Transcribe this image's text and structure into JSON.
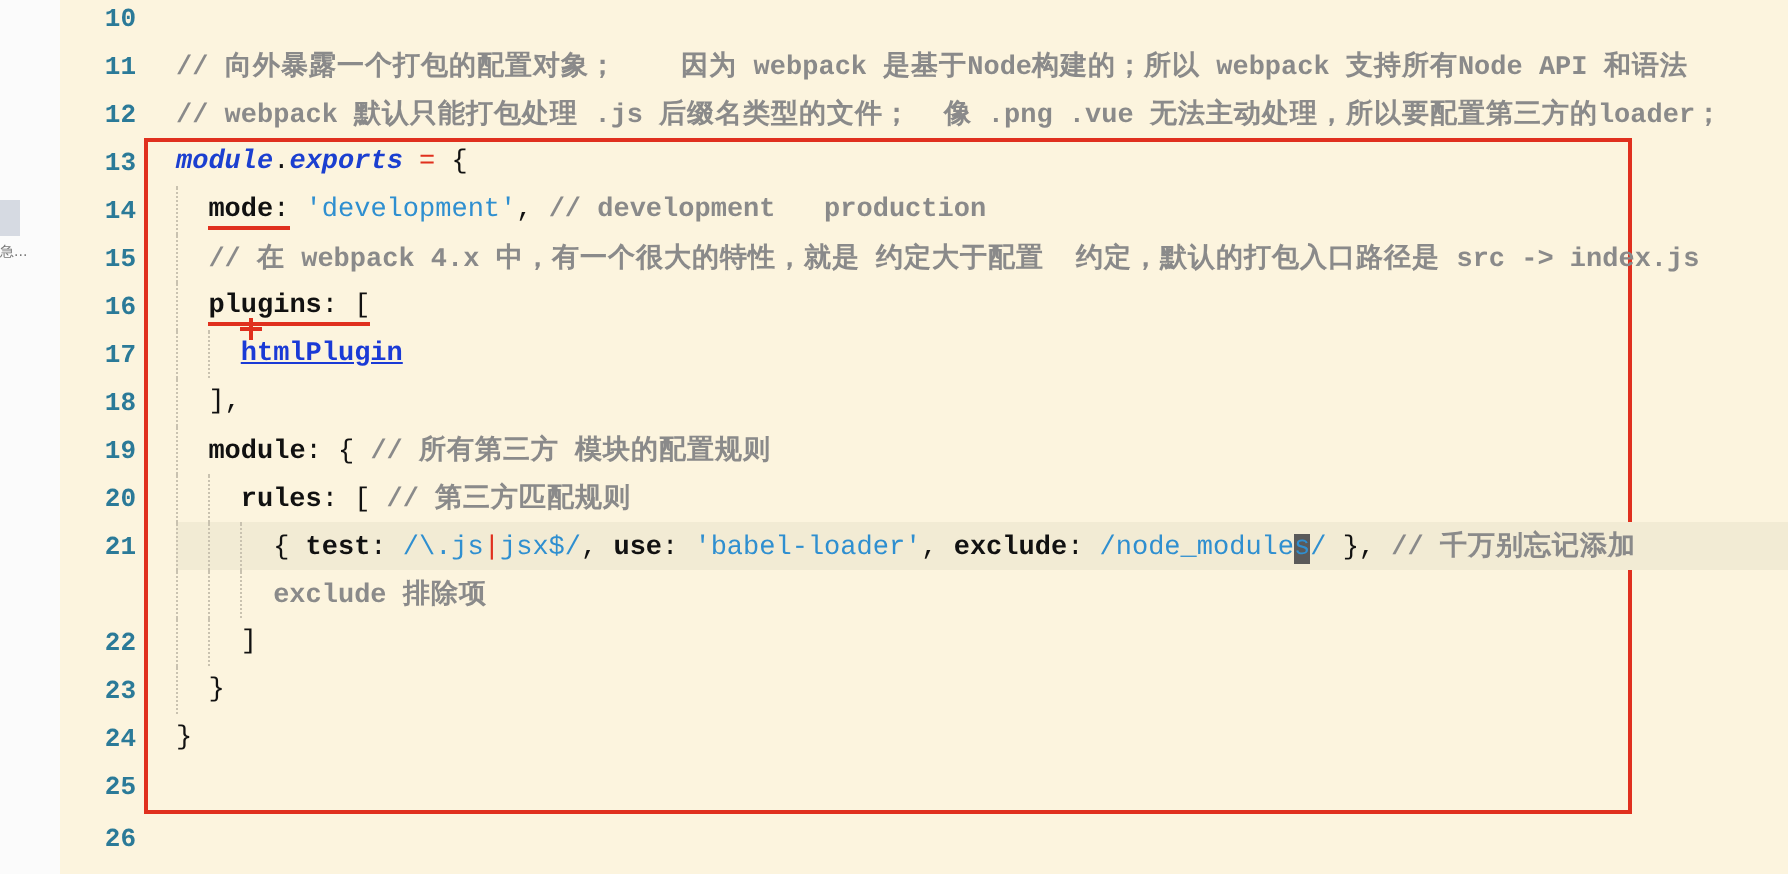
{
  "sidebar": {
    "item_text": "急..."
  },
  "editor": {
    "lines_before": [
      {
        "number": "10"
      },
      {
        "number": "11",
        "tokens": [
          {
            "kind": "comment",
            "text": "// 向外暴露一个打包的配置对象；    因为 webpack 是基于Node构建的；所以 webpack 支持所有Node API 和语法"
          }
        ]
      },
      {
        "number": "12",
        "tokens": [
          {
            "kind": "comment",
            "text": "// webpack 默认只能打包处理 .js 后缀名类型的文件；  像 .png .vue 无法主动处理，所以要配置第三方的loader；"
          }
        ]
      }
    ],
    "boxed_lines": [
      {
        "number": "13",
        "tokens": [
          {
            "kind": "keyword",
            "text": "module"
          },
          {
            "kind": "punct",
            "text": "."
          },
          {
            "kind": "keyword",
            "text": "exports"
          },
          {
            "kind": "operator",
            "text": " = "
          },
          {
            "kind": "punct",
            "text": "{"
          }
        ],
        "children": [
          {
            "number": "14",
            "tokens": [
              {
                "kind": "key",
                "text": "mode",
                "underlined": true
              },
              {
                "kind": "punct",
                "text": ":",
                "underlined": true
              },
              {
                "kind": "string",
                "text": " 'development'"
              },
              {
                "kind": "punct",
                "text": ", "
              },
              {
                "kind": "comment",
                "text": "// development   production"
              }
            ]
          },
          {
            "number": "15",
            "tokens": [
              {
                "kind": "comment",
                "text": "// 在 webpack 4.x 中，有一个很大的特性，就是 约定大于配置  约定，默认的打包入口路径是 src -> index.js"
              }
            ]
          },
          {
            "number": "16",
            "tokens": [
              {
                "kind": "key",
                "text": "plugins",
                "underlined": true
              },
              {
                "kind": "punct",
                "text": ": [",
                "underlined": true
              }
            ],
            "children": [
              {
                "number": "17",
                "mouse_cursor": true,
                "tokens": [
                  {
                    "kind": "link",
                    "text": "htmlPlugin"
                  }
                ]
              }
            ]
          },
          {
            "number": "18",
            "tokens": [
              {
                "kind": "punct",
                "text": "],"
              }
            ]
          },
          {
            "number": "19",
            "tokens": [
              {
                "kind": "key",
                "text": "module"
              },
              {
                "kind": "punct",
                "text": ": { "
              },
              {
                "kind": "comment",
                "text": "// 所有第三方 模块的配置规则"
              }
            ],
            "children": [
              {
                "number": "20",
                "tokens": [
                  {
                    "kind": "key",
                    "text": "rules"
                  },
                  {
                    "kind": "punct",
                    "text": ": [ "
                  },
                  {
                    "kind": "comment",
                    "text": "// 第三方匹配规则"
                  }
                ],
                "children": [
                  {
                    "number": "21",
                    "active": true,
                    "tokens": [
                      {
                        "kind": "punct",
                        "text": "{ "
                      },
                      {
                        "kind": "key",
                        "text": "test"
                      },
                      {
                        "kind": "punct",
                        "text": ": "
                      },
                      {
                        "kind": "regex",
                        "text": "/\\.js"
                      },
                      {
                        "kind": "operator",
                        "text": "|"
                      },
                      {
                        "kind": "regex",
                        "text": "jsx$/"
                      },
                      {
                        "kind": "punct",
                        "text": ", "
                      },
                      {
                        "kind": "key",
                        "text": "use"
                      },
                      {
                        "kind": "punct",
                        "text": ": "
                      },
                      {
                        "kind": "string",
                        "text": "'babel-loader'"
                      },
                      {
                        "kind": "punct",
                        "text": ", "
                      },
                      {
                        "kind": "key",
                        "text": "exclude"
                      },
                      {
                        "kind": "punct",
                        "text": ": "
                      },
                      {
                        "kind": "regex",
                        "text": "/node_module"
                      },
                      {
                        "kind": "cursor",
                        "text": "s"
                      },
                      {
                        "kind": "regex",
                        "text": "/"
                      },
                      {
                        "kind": "punct",
                        "text": " }, "
                      },
                      {
                        "kind": "comment",
                        "text": "// 千万别忘记添加"
                      }
                    ],
                    "continuation": [
                      {
                        "kind": "comment",
                        "text": "exclude 排除项"
                      }
                    ]
                  }
                ]
              },
              {
                "number": "22",
                "tokens": [
                  {
                    "kind": "punct",
                    "text": "]"
                  }
                ]
              }
            ]
          },
          {
            "number": "23",
            "tokens": [
              {
                "kind": "punct",
                "text": "}"
              }
            ]
          }
        ]
      },
      {
        "number": "24",
        "tokens": [
          {
            "kind": "punct",
            "text": "}"
          }
        ]
      },
      {
        "number": "25"
      }
    ],
    "lines_after": [
      {
        "number": "26"
      }
    ]
  }
}
